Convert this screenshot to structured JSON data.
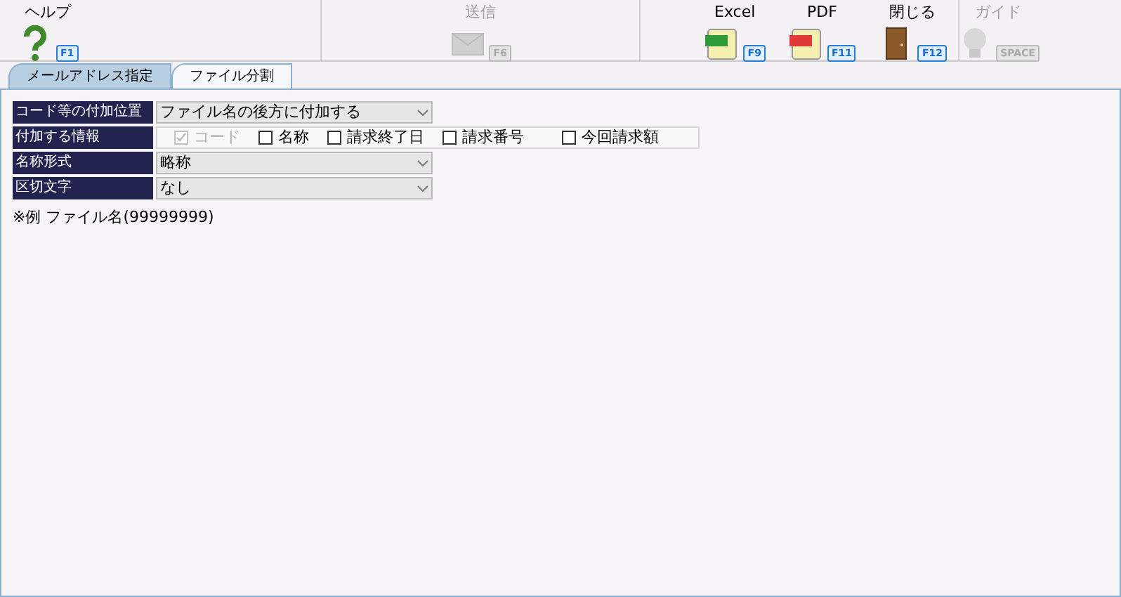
{
  "toolbar": {
    "groups": [
      {
        "items": [
          {
            "label": "ヘルプ",
            "kind": "help",
            "key": "F1",
            "disabled": false
          }
        ]
      },
      {
        "items": [
          {
            "label": "送信",
            "kind": "mail",
            "key": "F6",
            "disabled": true
          }
        ]
      },
      {
        "items": [
          {
            "label": "Excel",
            "kind": "excel",
            "key": "F9",
            "disabled": false
          },
          {
            "label": "PDF",
            "kind": "pdf",
            "key": "F11",
            "disabled": false
          },
          {
            "label": "閉じる",
            "kind": "close",
            "key": "F12",
            "disabled": false
          }
        ]
      },
      {
        "items": [
          {
            "label": "ガイド",
            "kind": "guide",
            "key": "SPACE",
            "disabled": true
          }
        ]
      }
    ]
  },
  "tabs": [
    {
      "label": "メールアドレス指定",
      "selected": false
    },
    {
      "label": "ファイル分割",
      "selected": true
    }
  ],
  "form": {
    "rows": [
      {
        "label": "コード等の付加位置",
        "kind": "select",
        "value": "ファイル名の後方に付加する"
      },
      {
        "label": "付加する情報",
        "kind": "checks",
        "options": [
          {
            "label": "コード",
            "checked": true,
            "disabled": true
          },
          {
            "label": "名称",
            "checked": false,
            "disabled": false
          },
          {
            "label": "請求終了日",
            "checked": false,
            "disabled": false
          },
          {
            "label": "請求番号",
            "checked": false,
            "disabled": false
          },
          {
            "label": "今回請求額",
            "checked": false,
            "disabled": false
          }
        ]
      },
      {
        "label": "名称形式",
        "kind": "select",
        "value": "略称"
      },
      {
        "label": "区切文字",
        "kind": "select",
        "value": "なし"
      }
    ],
    "example": "※例 ファイル名(99999999)"
  }
}
